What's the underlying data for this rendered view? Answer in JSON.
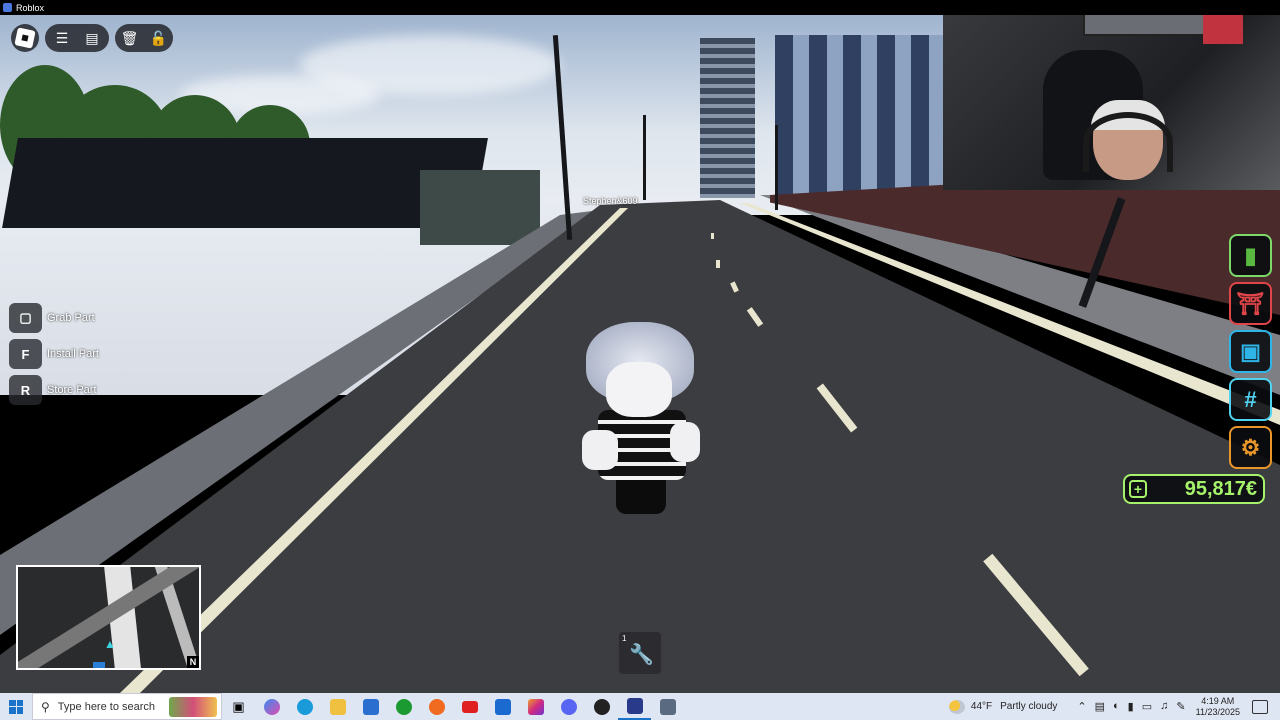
{
  "window": {
    "title": "Roblox"
  },
  "hud": {
    "player_name": "Stephen&609",
    "hints": [
      {
        "key": "",
        "label": "Grab Part",
        "icon": "mouse-icon"
      },
      {
        "key": "F",
        "label": "Install Part"
      },
      {
        "key": "R",
        "label": "Store Part"
      }
    ],
    "side_menu": [
      {
        "name": "book-menu-button",
        "icon": "book-icon",
        "color": "#7dd86a"
      },
      {
        "name": "shop-menu-button",
        "icon": "shop-icon",
        "color": "#e0454a"
      },
      {
        "name": "backpack-menu-button",
        "icon": "backpack-icon",
        "color": "#2fb4e8"
      },
      {
        "name": "hashtag-menu-button",
        "icon": "hashtag-icon",
        "color": "#4fd3f0"
      },
      {
        "name": "settings-menu-button",
        "icon": "gear-icon",
        "color": "#e8962a"
      }
    ],
    "money": "95,817€",
    "money_color": "#a6f26a",
    "hotbar": {
      "slot_number": "1",
      "tool_icon": "wrench-icon"
    },
    "minimap": {
      "north_label": "N"
    }
  },
  "taskbar": {
    "search_placeholder": "Type here to search",
    "weather_temp": "44°F",
    "weather_desc": "Partly cloudy",
    "time": "4:19 AM",
    "date": "11/23/2025",
    "apps": [
      "task-view-icon",
      "copilot-icon",
      "edge-icon",
      "file-explorer-icon",
      "store-icon",
      "xbox-icon",
      "firefox-icon",
      "youtube-icon",
      "outlook-icon",
      "instagram-icon",
      "discord-icon",
      "obs-icon",
      "roblox-icon",
      "roblox-studio-icon"
    ]
  }
}
